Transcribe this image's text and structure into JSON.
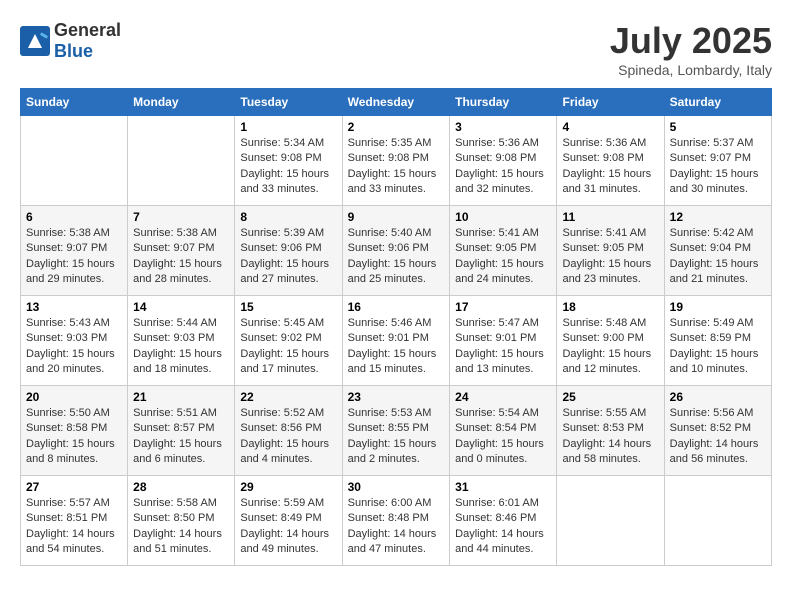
{
  "logo": {
    "general": "General",
    "blue": "Blue"
  },
  "header": {
    "month": "July 2025",
    "location": "Spineda, Lombardy, Italy"
  },
  "weekdays": [
    "Sunday",
    "Monday",
    "Tuesday",
    "Wednesday",
    "Thursday",
    "Friday",
    "Saturday"
  ],
  "weeks": [
    [
      {
        "day": "",
        "sunrise": "",
        "sunset": "",
        "daylight": ""
      },
      {
        "day": "",
        "sunrise": "",
        "sunset": "",
        "daylight": ""
      },
      {
        "day": "1",
        "sunrise": "Sunrise: 5:34 AM",
        "sunset": "Sunset: 9:08 PM",
        "daylight": "Daylight: 15 hours and 33 minutes."
      },
      {
        "day": "2",
        "sunrise": "Sunrise: 5:35 AM",
        "sunset": "Sunset: 9:08 PM",
        "daylight": "Daylight: 15 hours and 33 minutes."
      },
      {
        "day": "3",
        "sunrise": "Sunrise: 5:36 AM",
        "sunset": "Sunset: 9:08 PM",
        "daylight": "Daylight: 15 hours and 32 minutes."
      },
      {
        "day": "4",
        "sunrise": "Sunrise: 5:36 AM",
        "sunset": "Sunset: 9:08 PM",
        "daylight": "Daylight: 15 hours and 31 minutes."
      },
      {
        "day": "5",
        "sunrise": "Sunrise: 5:37 AM",
        "sunset": "Sunset: 9:07 PM",
        "daylight": "Daylight: 15 hours and 30 minutes."
      }
    ],
    [
      {
        "day": "6",
        "sunrise": "Sunrise: 5:38 AM",
        "sunset": "Sunset: 9:07 PM",
        "daylight": "Daylight: 15 hours and 29 minutes."
      },
      {
        "day": "7",
        "sunrise": "Sunrise: 5:38 AM",
        "sunset": "Sunset: 9:07 PM",
        "daylight": "Daylight: 15 hours and 28 minutes."
      },
      {
        "day": "8",
        "sunrise": "Sunrise: 5:39 AM",
        "sunset": "Sunset: 9:06 PM",
        "daylight": "Daylight: 15 hours and 27 minutes."
      },
      {
        "day": "9",
        "sunrise": "Sunrise: 5:40 AM",
        "sunset": "Sunset: 9:06 PM",
        "daylight": "Daylight: 15 hours and 25 minutes."
      },
      {
        "day": "10",
        "sunrise": "Sunrise: 5:41 AM",
        "sunset": "Sunset: 9:05 PM",
        "daylight": "Daylight: 15 hours and 24 minutes."
      },
      {
        "day": "11",
        "sunrise": "Sunrise: 5:41 AM",
        "sunset": "Sunset: 9:05 PM",
        "daylight": "Daylight: 15 hours and 23 minutes."
      },
      {
        "day": "12",
        "sunrise": "Sunrise: 5:42 AM",
        "sunset": "Sunset: 9:04 PM",
        "daylight": "Daylight: 15 hours and 21 minutes."
      }
    ],
    [
      {
        "day": "13",
        "sunrise": "Sunrise: 5:43 AM",
        "sunset": "Sunset: 9:03 PM",
        "daylight": "Daylight: 15 hours and 20 minutes."
      },
      {
        "day": "14",
        "sunrise": "Sunrise: 5:44 AM",
        "sunset": "Sunset: 9:03 PM",
        "daylight": "Daylight: 15 hours and 18 minutes."
      },
      {
        "day": "15",
        "sunrise": "Sunrise: 5:45 AM",
        "sunset": "Sunset: 9:02 PM",
        "daylight": "Daylight: 15 hours and 17 minutes."
      },
      {
        "day": "16",
        "sunrise": "Sunrise: 5:46 AM",
        "sunset": "Sunset: 9:01 PM",
        "daylight": "Daylight: 15 hours and 15 minutes."
      },
      {
        "day": "17",
        "sunrise": "Sunrise: 5:47 AM",
        "sunset": "Sunset: 9:01 PM",
        "daylight": "Daylight: 15 hours and 13 minutes."
      },
      {
        "day": "18",
        "sunrise": "Sunrise: 5:48 AM",
        "sunset": "Sunset: 9:00 PM",
        "daylight": "Daylight: 15 hours and 12 minutes."
      },
      {
        "day": "19",
        "sunrise": "Sunrise: 5:49 AM",
        "sunset": "Sunset: 8:59 PM",
        "daylight": "Daylight: 15 hours and 10 minutes."
      }
    ],
    [
      {
        "day": "20",
        "sunrise": "Sunrise: 5:50 AM",
        "sunset": "Sunset: 8:58 PM",
        "daylight": "Daylight: 15 hours and 8 minutes."
      },
      {
        "day": "21",
        "sunrise": "Sunrise: 5:51 AM",
        "sunset": "Sunset: 8:57 PM",
        "daylight": "Daylight: 15 hours and 6 minutes."
      },
      {
        "day": "22",
        "sunrise": "Sunrise: 5:52 AM",
        "sunset": "Sunset: 8:56 PM",
        "daylight": "Daylight: 15 hours and 4 minutes."
      },
      {
        "day": "23",
        "sunrise": "Sunrise: 5:53 AM",
        "sunset": "Sunset: 8:55 PM",
        "daylight": "Daylight: 15 hours and 2 minutes."
      },
      {
        "day": "24",
        "sunrise": "Sunrise: 5:54 AM",
        "sunset": "Sunset: 8:54 PM",
        "daylight": "Daylight: 15 hours and 0 minutes."
      },
      {
        "day": "25",
        "sunrise": "Sunrise: 5:55 AM",
        "sunset": "Sunset: 8:53 PM",
        "daylight": "Daylight: 14 hours and 58 minutes."
      },
      {
        "day": "26",
        "sunrise": "Sunrise: 5:56 AM",
        "sunset": "Sunset: 8:52 PM",
        "daylight": "Daylight: 14 hours and 56 minutes."
      }
    ],
    [
      {
        "day": "27",
        "sunrise": "Sunrise: 5:57 AM",
        "sunset": "Sunset: 8:51 PM",
        "daylight": "Daylight: 14 hours and 54 minutes."
      },
      {
        "day": "28",
        "sunrise": "Sunrise: 5:58 AM",
        "sunset": "Sunset: 8:50 PM",
        "daylight": "Daylight: 14 hours and 51 minutes."
      },
      {
        "day": "29",
        "sunrise": "Sunrise: 5:59 AM",
        "sunset": "Sunset: 8:49 PM",
        "daylight": "Daylight: 14 hours and 49 minutes."
      },
      {
        "day": "30",
        "sunrise": "Sunrise: 6:00 AM",
        "sunset": "Sunset: 8:48 PM",
        "daylight": "Daylight: 14 hours and 47 minutes."
      },
      {
        "day": "31",
        "sunrise": "Sunrise: 6:01 AM",
        "sunset": "Sunset: 8:46 PM",
        "daylight": "Daylight: 14 hours and 44 minutes."
      },
      {
        "day": "",
        "sunrise": "",
        "sunset": "",
        "daylight": ""
      },
      {
        "day": "",
        "sunrise": "",
        "sunset": "",
        "daylight": ""
      }
    ]
  ]
}
